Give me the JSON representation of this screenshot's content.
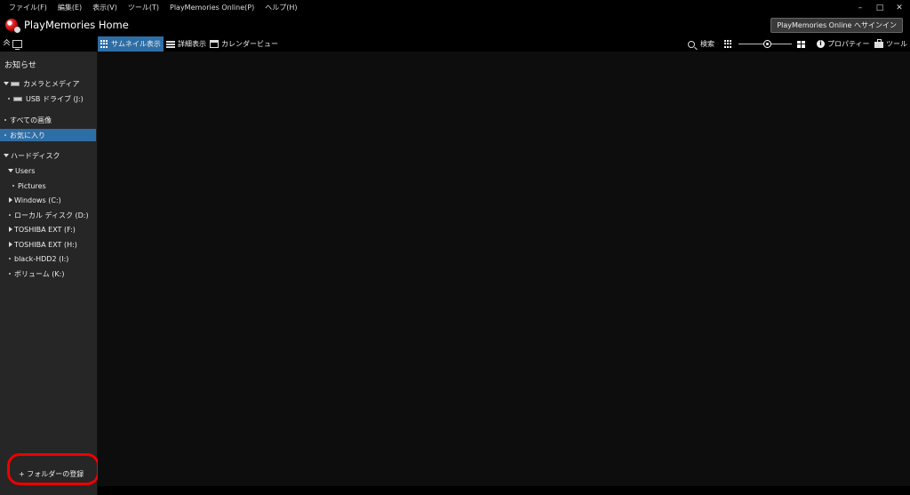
{
  "menu": {
    "items": [
      "ファイル(F)",
      "編集(E)",
      "表示(V)",
      "ツール(T)",
      "PlayMemories Online(P)",
      "ヘルプ(H)"
    ]
  },
  "window_controls": {
    "minimize": "–",
    "maximize": "□",
    "close": "✕"
  },
  "app": {
    "title": "PlayMemories Home"
  },
  "signin": {
    "label": "PlayMemories Online へサインイン"
  },
  "toolbar": {
    "thumbnail_view": "サムネイル表示",
    "detail_view": "詳細表示",
    "calendar_view": "カレンダービュー",
    "search": "検索",
    "properties": "プロパティー",
    "tools": "ツール"
  },
  "sidebar": {
    "notice": "お知らせ",
    "camera_media": "カメラとメディア",
    "usb_drive": "USB ドライブ (J:)",
    "all_images": "すべての画像",
    "favorites": "お気に入り",
    "hard_disk": "ハードディスク",
    "users": "Users",
    "pictures": "Pictures",
    "windows_c": "Windows (C:)",
    "local_d": "ローカル ディスク (D:)",
    "toshiba_f": "TOSHIBA EXT (F:)",
    "toshiba_h": "TOSHIBA EXT (H:)",
    "black_hdd": "black-HDD2 (I:)",
    "volume_k": "ボリューム (K:)",
    "add_folder": "+ フォルダーの登録"
  },
  "colors": {
    "accent": "#2e6ea6",
    "highlight": "#e00000",
    "sidebar_bg": "#262626",
    "main_bg": "#0d0d0d"
  }
}
